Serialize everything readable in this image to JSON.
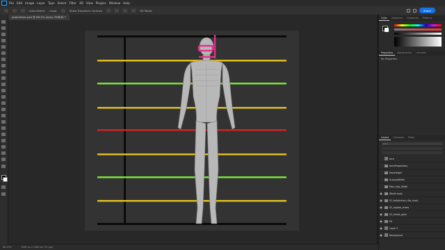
{
  "menu": {
    "logo": "Ps",
    "items": [
      "File",
      "Edit",
      "Image",
      "Layer",
      "Type",
      "Select",
      "Filter",
      "3D",
      "View",
      "Plugins",
      "Window",
      "Help"
    ]
  },
  "options": {
    "auto_select": "Auto-Select:",
    "layer_value": "Layer",
    "show_transform": "Show Transform Controls",
    "mode_3d": "3D Mode:",
    "share": "Share"
  },
  "document": {
    "tab_title": "projections.psd @ 86.2% (eyes, RGB/8) *"
  },
  "status": {
    "zoom": "86.25%",
    "doc_info": "1080 px x 1080 px (72 ppi)"
  },
  "panels": {
    "color_tabs": [
      "Color",
      "Swatches",
      "Gradients",
      "Patterns"
    ],
    "props_tabs": [
      "Properties",
      "Adjustments",
      "Libraries"
    ],
    "no_properties": "No Properties",
    "layer_tabs": [
      "Layers",
      "Channels",
      "Paths"
    ],
    "search_kind": "Kind",
    "layers": [
      {
        "name": "face",
        "type": "layer",
        "visible": false
      },
      {
        "name": "armsProportions",
        "type": "folder",
        "visible": false
      },
      {
        "name": "FaceHeight",
        "type": "folder",
        "visible": false
      },
      {
        "name": "ScapulaWidth",
        "type": "folder",
        "visible": false
      },
      {
        "name": "Ribs_Hips_Width",
        "type": "folder",
        "visible": false
      },
      {
        "name": "Whole body",
        "type": "folder",
        "visible": true
      },
      {
        "name": "02_bellybutton_ribs_head",
        "type": "folder",
        "visible": true
      },
      {
        "name": "02_nipples_knees",
        "type": "folder",
        "visible": true
      },
      {
        "name": "02_hands_groin",
        "type": "folder",
        "visible": true
      },
      {
        "name": "00",
        "type": "folder",
        "visible": true
      },
      {
        "name": "Layer 3",
        "type": "layer",
        "visible": true
      },
      {
        "name": "Background",
        "type": "layer",
        "visible": true
      }
    ]
  },
  "colors": {
    "accent": "#1473e6",
    "guide_yellow": "#e0c020",
    "guide_green": "#7ee33a",
    "guide_red": "#d42020",
    "face_marker": "#e0338a"
  }
}
